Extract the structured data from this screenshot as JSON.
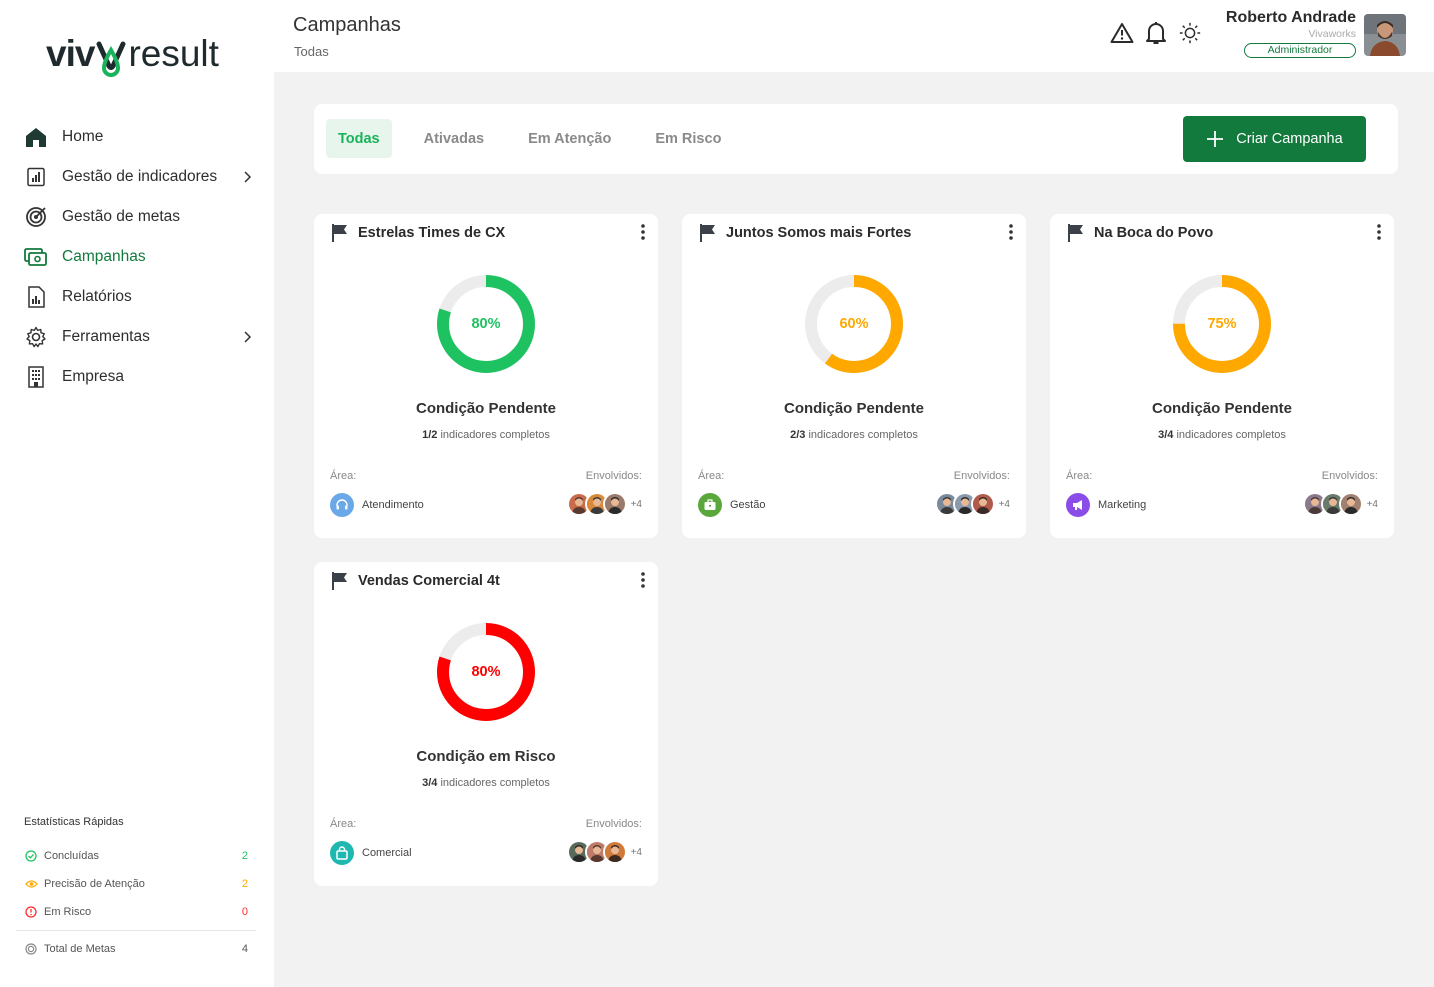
{
  "brand": {
    "part1": "viv",
    "part2": "result"
  },
  "sidebar": {
    "items": [
      {
        "label": "Home",
        "icon": "home-icon"
      },
      {
        "label": "Gestão de indicadores",
        "icon": "chart-icon"
      },
      {
        "label": "Gestão de metas",
        "icon": "target-icon"
      },
      {
        "label": "Campanhas",
        "icon": "campaign-icon"
      },
      {
        "label": "Relatórios",
        "icon": "report-icon"
      },
      {
        "label": "Ferramentas",
        "icon": "gear-icon"
      },
      {
        "label": "Empresa",
        "icon": "building-icon"
      }
    ],
    "stats": {
      "title": "Estatísticas Rápidas",
      "rows": [
        {
          "label": "Concluídas",
          "value": "2"
        },
        {
          "label": "Precisão de Atenção",
          "value": "2"
        },
        {
          "label": "Em Risco",
          "value": "0"
        }
      ],
      "total": {
        "label": "Total de Metas",
        "value": "4"
      }
    }
  },
  "header": {
    "title": "Campanhas",
    "subtitle": "Todas",
    "user": {
      "name": "Roberto Andrade",
      "org": "Vivaworks",
      "role": "Administrador"
    }
  },
  "tabs": [
    {
      "label": "Todas"
    },
    {
      "label": "Ativadas"
    },
    {
      "label": "Em Atenção"
    },
    {
      "label": "Em Risco"
    }
  ],
  "create_button": "Criar Campanha",
  "labels": {
    "area": "Área:",
    "involved": "Envolvidos:",
    "progress_suffix": "indicadores completos"
  },
  "colors": {
    "brand": "#127a3d",
    "green": "#1ec261",
    "orange": "#ffa800",
    "red": "#ff0000"
  },
  "cards": [
    {
      "title": "Estrelas Times de CX",
      "percent": 80,
      "percent_label": "80%",
      "color": "#1ec261",
      "status": "Condição Pendente",
      "progress": "1/2",
      "area": "Atendimento",
      "area_color": "#6aa8e8",
      "area_icon": "headset-icon",
      "more": "+4"
    },
    {
      "title": "Juntos Somos mais Fortes",
      "percent": 60,
      "percent_label": "60%",
      "color": "#ffa800",
      "status": "Condição Pendente",
      "progress": "2/3",
      "area": "Gestão",
      "area_color": "#5aa83c",
      "area_icon": "briefcase-icon",
      "more": "+4"
    },
    {
      "title": "Na Boca do Povo",
      "percent": 75,
      "percent_label": "75%",
      "color": "#ffa800",
      "status": "Condição Pendente",
      "progress": "3/4",
      "area": "Marketing",
      "area_color": "#8a4de8",
      "area_icon": "megaphone-icon",
      "more": "+4"
    },
    {
      "title": "Vendas Comercial 4t",
      "percent": 80,
      "percent_label": "80%",
      "color": "#ff0000",
      "status": "Condição em Risco",
      "progress": "3/4",
      "area": "Comercial",
      "area_color": "#1fb8b0",
      "area_icon": "bag-icon",
      "more": "+4"
    }
  ]
}
